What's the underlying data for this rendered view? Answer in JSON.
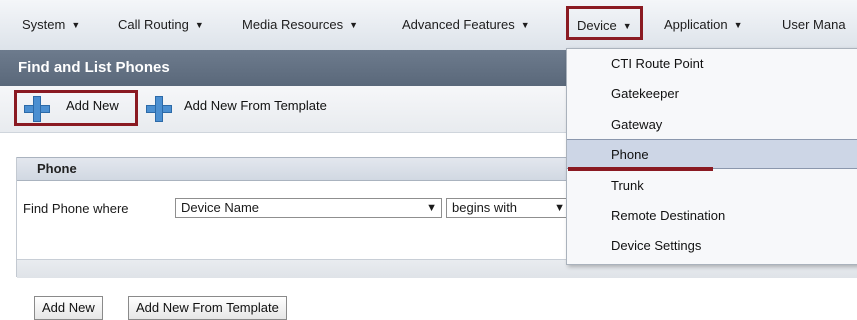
{
  "menubar": {
    "items": [
      {
        "label": "System"
      },
      {
        "label": "Call Routing"
      },
      {
        "label": "Media Resources"
      },
      {
        "label": "Advanced Features"
      },
      {
        "label": "Device"
      },
      {
        "label": "Application"
      },
      {
        "label": "User Mana"
      }
    ]
  },
  "page": {
    "title": "Find and List Phones"
  },
  "toolbar": {
    "add_new_label": "Add New",
    "add_new_from_template_label": "Add New From Template"
  },
  "phone_section": {
    "title": "Phone",
    "find_label": "Find Phone where",
    "field_select": "Device Name",
    "operator_select": "begins with"
  },
  "bottom_buttons": {
    "add_new_label": "Add New",
    "add_new_from_template_label": "Add New From Template"
  },
  "device_menu": {
    "items": [
      {
        "label": "CTI Route Point"
      },
      {
        "label": "Gatekeeper"
      },
      {
        "label": "Gateway"
      },
      {
        "label": "Phone"
      },
      {
        "label": "Trunk"
      },
      {
        "label": "Remote Destination"
      },
      {
        "label": "Device Settings"
      }
    ],
    "selected": "Phone"
  },
  "colors": {
    "highlight_border": "#8a1a22",
    "title_bar": "#64728a",
    "selected_item": "#cdd6e6",
    "plus_icon": "#4b8fd1"
  }
}
